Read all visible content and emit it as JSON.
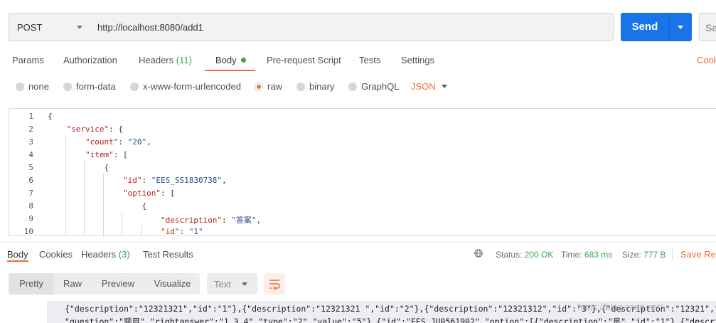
{
  "request": {
    "method": "POST",
    "url": "http://localhost:8080/add1",
    "send_label": "Send",
    "save_label": "Sa"
  },
  "request_tabs": {
    "params": "Params",
    "authorization": "Authorization",
    "headers": "Headers",
    "headers_count": "(11)",
    "body": "Body",
    "pre_request": "Pre-request Script",
    "tests": "Tests",
    "settings": "Settings",
    "cookies": "Cook"
  },
  "body_types": {
    "none": "none",
    "form_data": "form-data",
    "urlencoded": "x-www-form-urlencoded",
    "raw": "raw",
    "binary": "binary",
    "graphql": "GraphQL",
    "format": "JSON",
    "selected": "raw"
  },
  "editor": {
    "line_numbers": [
      "1",
      "2",
      "3",
      "4",
      "5",
      "6",
      "7",
      "8",
      "9",
      "10"
    ],
    "lines": [
      {
        "indent": "",
        "key": "",
        "sep": "",
        "val": "",
        "tail": "{"
      },
      {
        "indent": "    ",
        "key": "\"service\"",
        "sep": ": ",
        "val": "",
        "tail": "{"
      },
      {
        "indent": "        ",
        "key": "\"count\"",
        "sep": ": ",
        "val": "\"20\"",
        "tail": ","
      },
      {
        "indent": "        ",
        "key": "\"item\"",
        "sep": ": ",
        "val": "",
        "tail": "["
      },
      {
        "indent": "            ",
        "key": "",
        "sep": "",
        "val": "",
        "tail": "{"
      },
      {
        "indent": "                ",
        "key": "\"id\"",
        "sep": ": ",
        "val": "\"EES_SS1830738\"",
        "tail": ","
      },
      {
        "indent": "                ",
        "key": "\"option\"",
        "sep": ": ",
        "val": "",
        "tail": "["
      },
      {
        "indent": "                    ",
        "key": "",
        "sep": "",
        "val": "",
        "tail": "{"
      },
      {
        "indent": "                        ",
        "key": "\"description\"",
        "sep": ": ",
        "val": "\"答案\"",
        "tail": ","
      },
      {
        "indent": "                        ",
        "key": "\"id\"",
        "sep": ": ",
        "val": "\"1\"",
        "tail": ""
      }
    ]
  },
  "response_tabs": {
    "body": "Body",
    "cookies": "Cookies",
    "headers": "Headers",
    "headers_count": "(3)",
    "test_results": "Test Results"
  },
  "response_meta": {
    "status_label": "Status:",
    "status_value": "200 OK",
    "time_label": "Time:",
    "time_value": "683 ms",
    "size_label": "Size:",
    "size_value": "777 B",
    "save_response": "Save Res"
  },
  "view_modes": {
    "pretty": "Pretty",
    "raw": "Raw",
    "preview": "Preview",
    "visualize": "Visualize",
    "text_format": "Text"
  },
  "response_body": {
    "line1": "{\"description\":\"12321321\",\"id\":\"1\"},{\"description\":\"12321321 \",\"id\":\"2\"},{\"description\":\"12321312\",\"id\":\"3\"},{\"description\":\"12321\",\"id\":\"4",
    "line2": "\"question\":\"题目\",\"rightanswer\":\"1,3,4\",\"type\":\"2\",\"value\":\"5\"},{\"id\":\"EES_JU0561902\",\"option\":[{\"description\":\"是\",\"id\":\"1\"},{\"description",
    "watermark": "https://blog.csdn.net/..."
  },
  "colors": {
    "accent": "#e8703a",
    "send": "#1a73e8",
    "status_ok": "#34a853"
  }
}
